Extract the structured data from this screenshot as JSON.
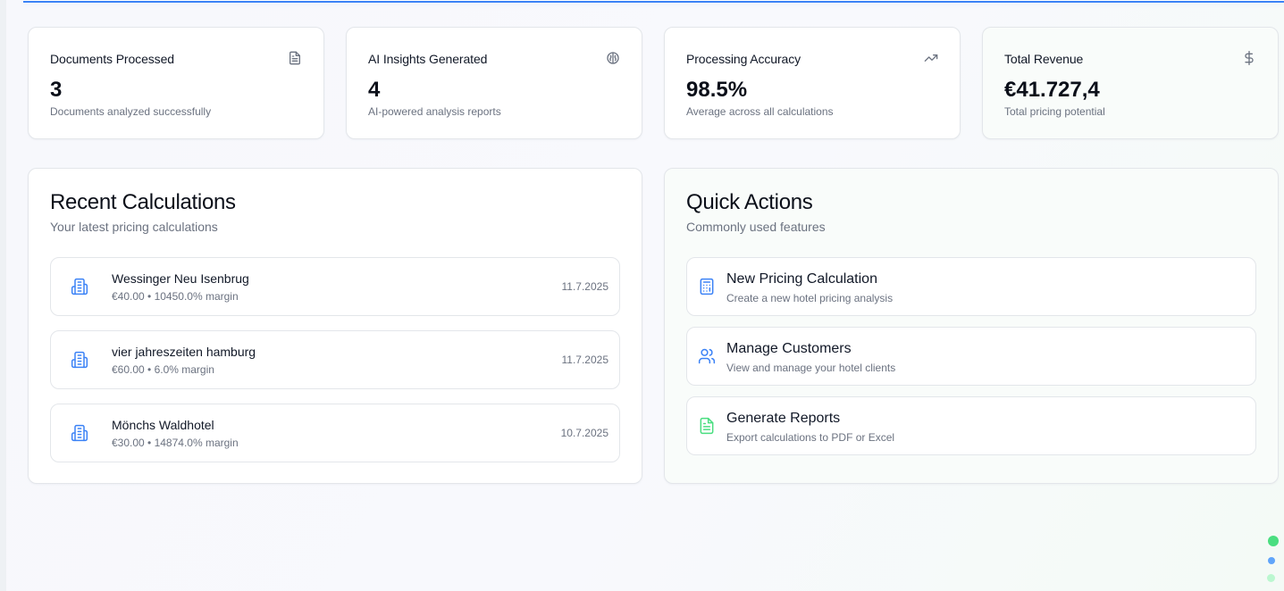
{
  "stats": [
    {
      "label": "Documents Processed",
      "value": "3",
      "sub": "Documents analyzed successfully",
      "icon": "file-text-icon"
    },
    {
      "label": "AI Insights Generated",
      "value": "4",
      "sub": "AI-powered analysis reports",
      "icon": "brain-icon"
    },
    {
      "label": "Processing Accuracy",
      "value": "98.5%",
      "sub": "Average across all calculations",
      "icon": "trending-up-icon"
    },
    {
      "label": "Total Revenue",
      "value": "€41.727,4",
      "sub": "Total pricing potential",
      "icon": "dollar-icon"
    }
  ],
  "recent": {
    "title": "Recent Calculations",
    "subtitle": "Your latest pricing calculations",
    "items": [
      {
        "name": "Wessinger Neu Isenbrug",
        "meta": "€40.00 • 10450.0% margin",
        "date": "11.7.2025"
      },
      {
        "name": "vier jahreszeiten hamburg",
        "meta": "€60.00 • 6.0% margin",
        "date": "11.7.2025"
      },
      {
        "name": "Mönchs Waldhotel",
        "meta": "€30.00 • 14874.0% margin",
        "date": "10.7.2025"
      }
    ]
  },
  "quick": {
    "title": "Quick Actions",
    "subtitle": "Commonly used features",
    "items": [
      {
        "name": "New Pricing Calculation",
        "meta": "Create a new hotel pricing analysis",
        "icon": "calculator-icon"
      },
      {
        "name": "Manage Customers",
        "meta": "View and manage your hotel clients",
        "icon": "users-icon"
      },
      {
        "name": "Generate Reports",
        "meta": "Export calculations to PDF or Excel",
        "icon": "file-report-icon"
      }
    ]
  },
  "colors": {
    "accent": "#3b82f6",
    "green": "#4ade80",
    "muted": "#6b7280"
  }
}
